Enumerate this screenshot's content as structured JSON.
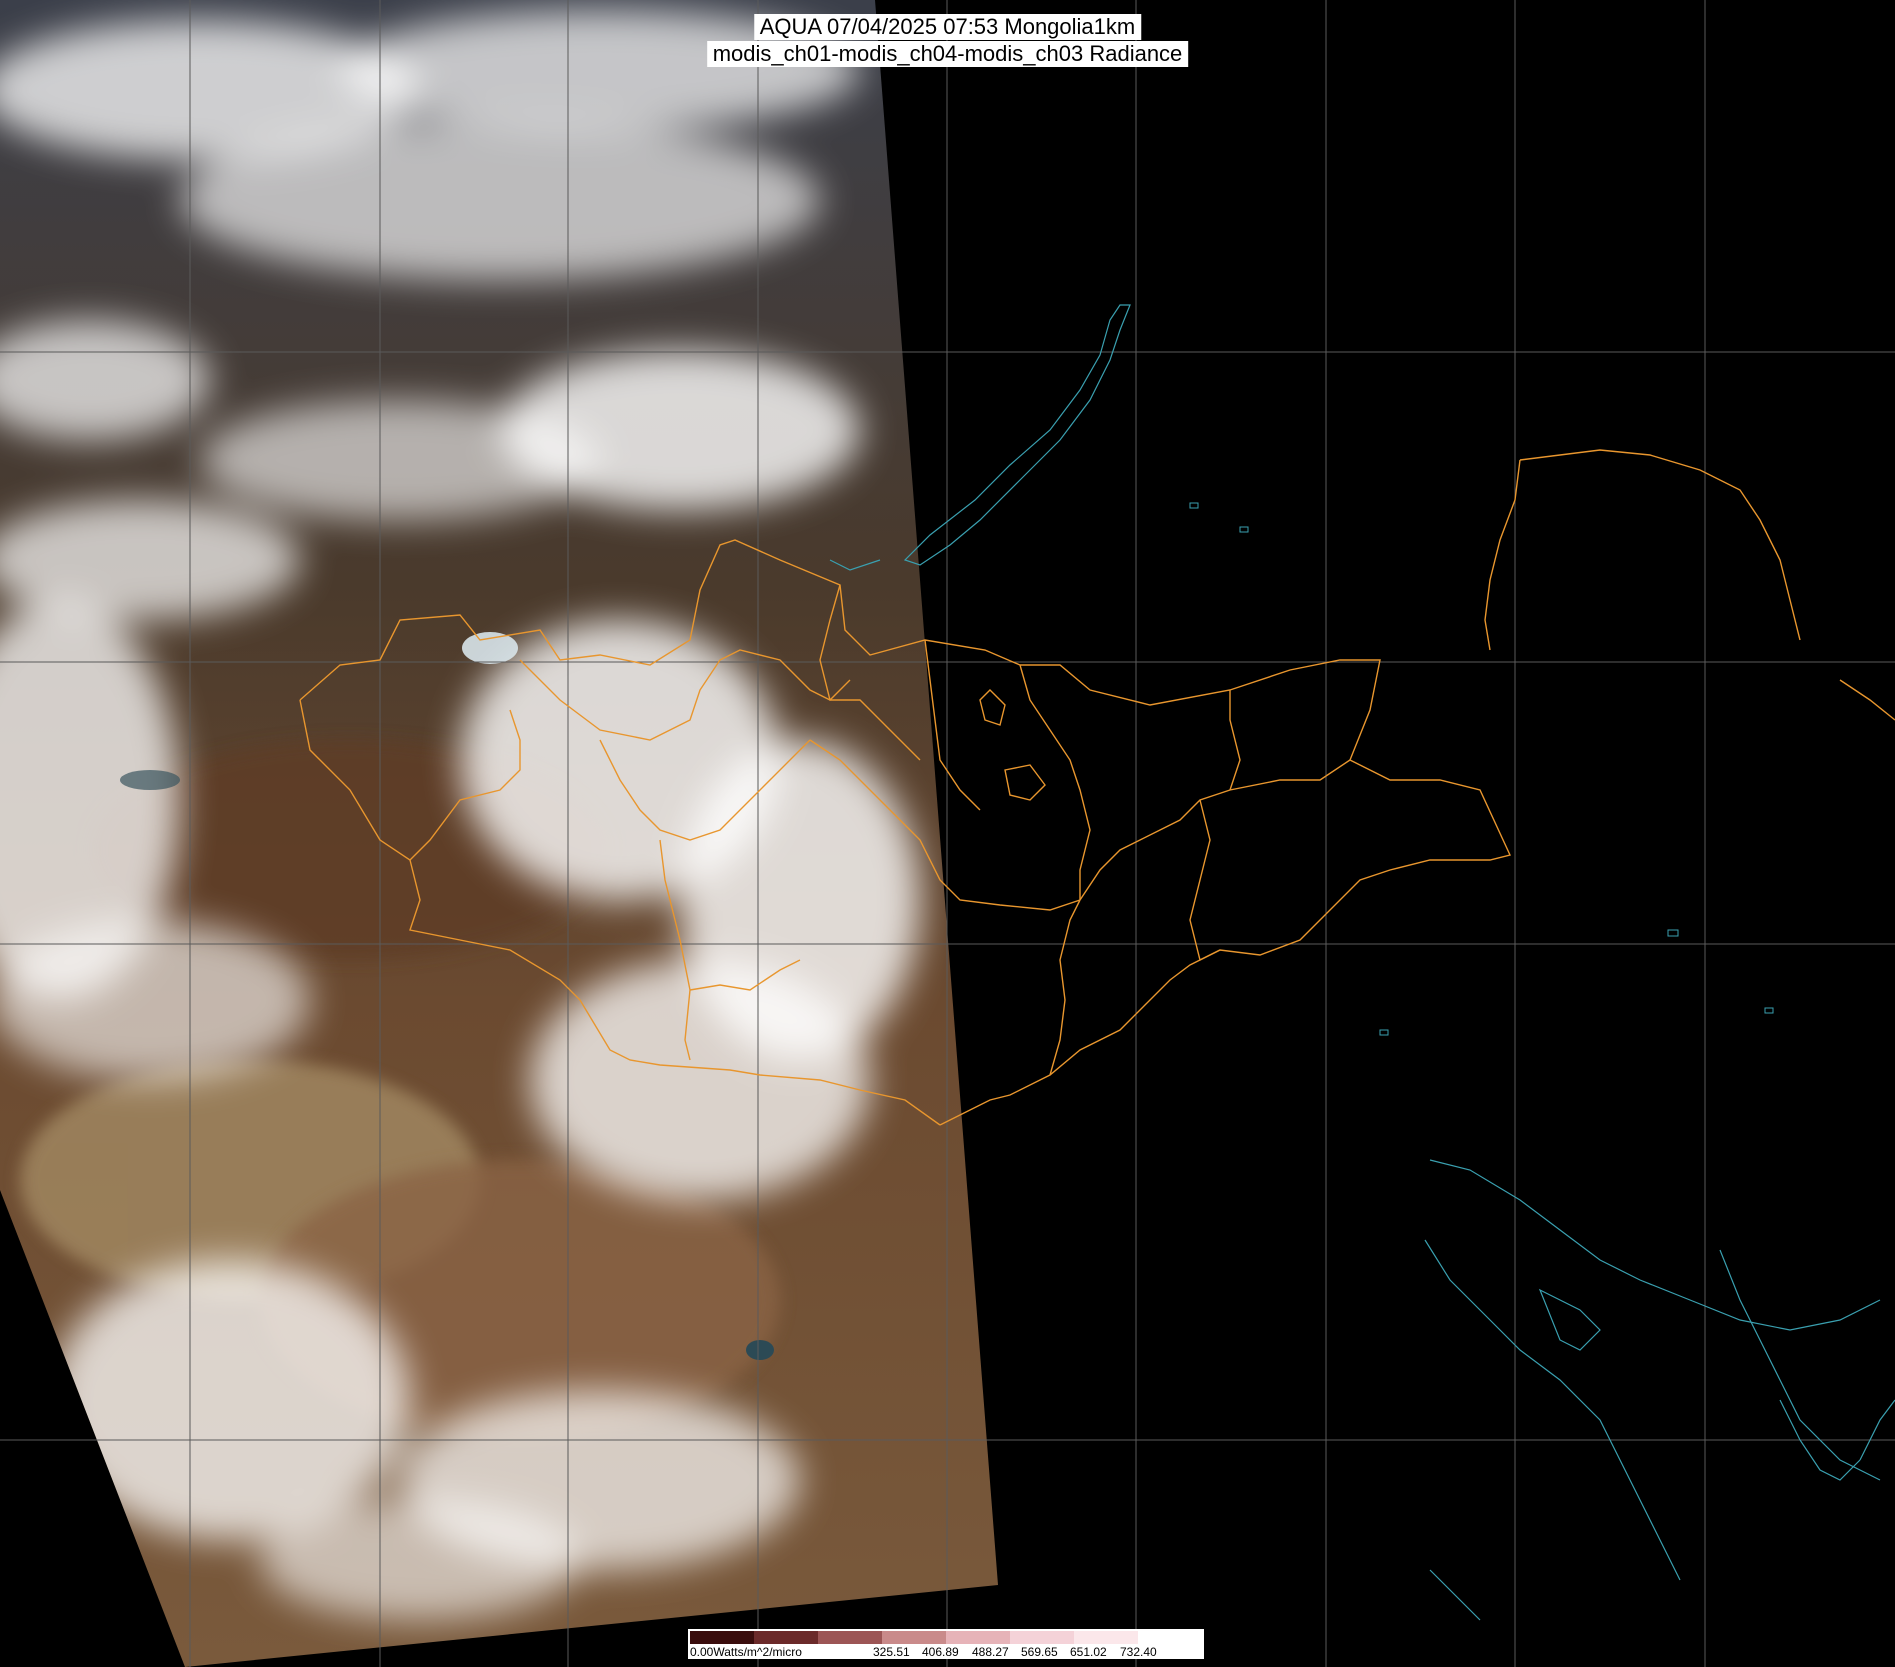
{
  "header": {
    "line1": "AQUA 07/04/2025 07:53 Mongolia1km",
    "line2": "modis_ch01-modis_ch04-modis_ch03 Radiance"
  },
  "image": {
    "content": "satellite true-color swath over Mongolia with clouds, province boundaries and coastlines",
    "boundary_color": "#e8962e",
    "coastline_color": "#3aa0b0",
    "grid_color": "#5a5a5a"
  },
  "legend": {
    "unit_label": "0.00Watts/m^2/micro",
    "ticks": [
      "325.51",
      "406.89",
      "488.27",
      "569.65",
      "651.02",
      "732.40"
    ],
    "colors": [
      "#3a0d0d",
      "#6b2a2a",
      "#9c5555",
      "#c98a8a",
      "#e6b3b8",
      "#f4d2d8",
      "#fbe7ea",
      "#ffffff"
    ]
  }
}
